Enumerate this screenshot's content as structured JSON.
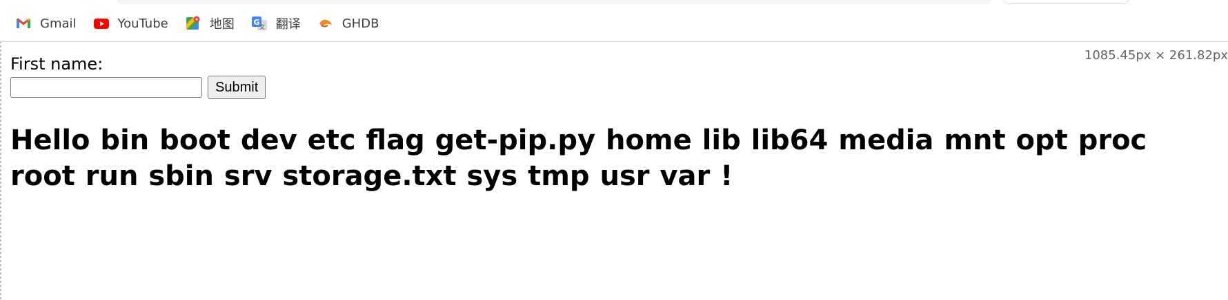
{
  "bookmarks": [
    {
      "label": "Gmail",
      "icon": "gmail-icon",
      "color": "#EA4335"
    },
    {
      "label": "YouTube",
      "icon": "youtube-icon",
      "color": "#FF0000"
    },
    {
      "label": "地图",
      "icon": "maps-icon",
      "color": "#34A853"
    },
    {
      "label": "翻译",
      "icon": "translate-icon",
      "color": "#4285F4"
    },
    {
      "label": "GHDB",
      "icon": "ghdb-icon",
      "color": "#F28C28"
    }
  ],
  "devtools": {
    "size_readout": "1085.45px × 261.82px"
  },
  "form": {
    "label": "First name:",
    "input_value": "",
    "submit_label": "Submit"
  },
  "output": {
    "greeting": "Hello bin boot dev etc flag get-pip.py home lib lib64 media mnt opt proc root run sbin srv storage.txt sys tmp usr var !"
  }
}
